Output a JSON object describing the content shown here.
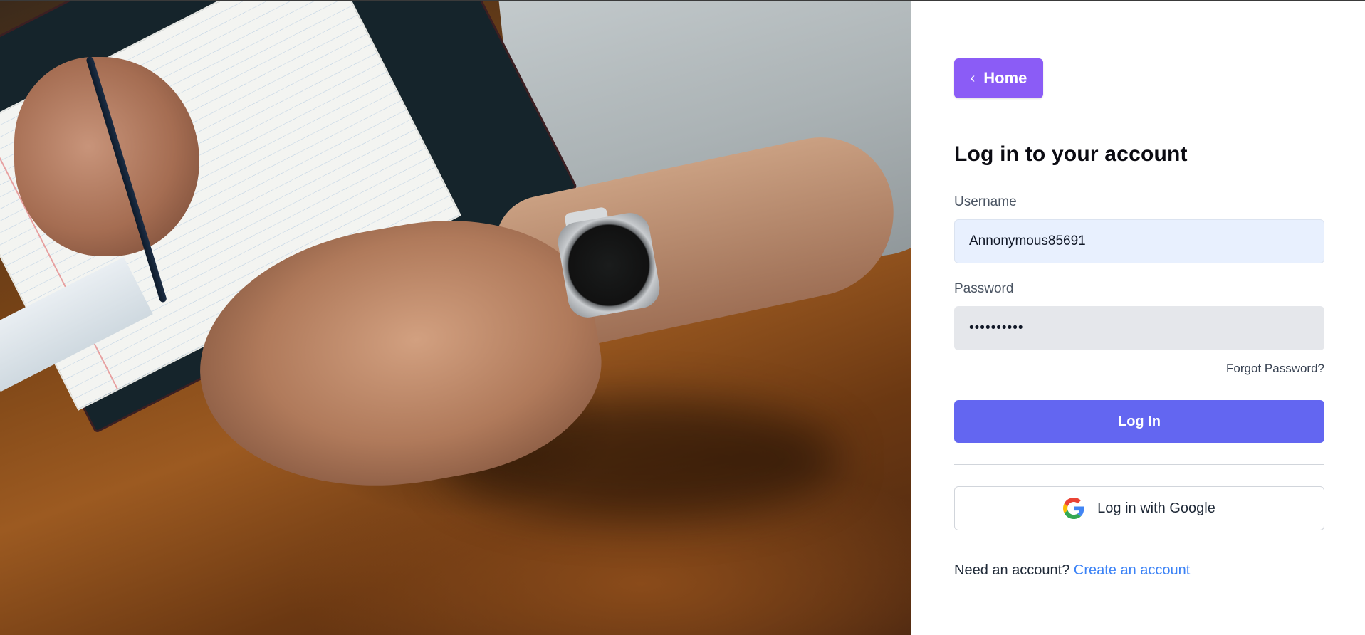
{
  "hero": {
    "description_icon": "desk-photo"
  },
  "nav": {
    "home_label": "Home",
    "back_icon": "chevron-left-icon"
  },
  "form": {
    "title": "Log in to your account",
    "username_label": "Username",
    "username_value": "Annonymous85691",
    "password_label": "Password",
    "password_value": "••••••••••",
    "forgot_label": "Forgot Password?",
    "submit_label": "Log In",
    "google_label": "Log in with Google",
    "google_icon": "google-icon",
    "signup_prompt": "Need an account?",
    "signup_link": "Create an account"
  },
  "colors": {
    "home_button": "#8b5cf6",
    "primary_button": "#6366f1",
    "link": "#3b82f6",
    "username_bg": "#e8f0fe",
    "password_bg": "#e5e7eb"
  }
}
